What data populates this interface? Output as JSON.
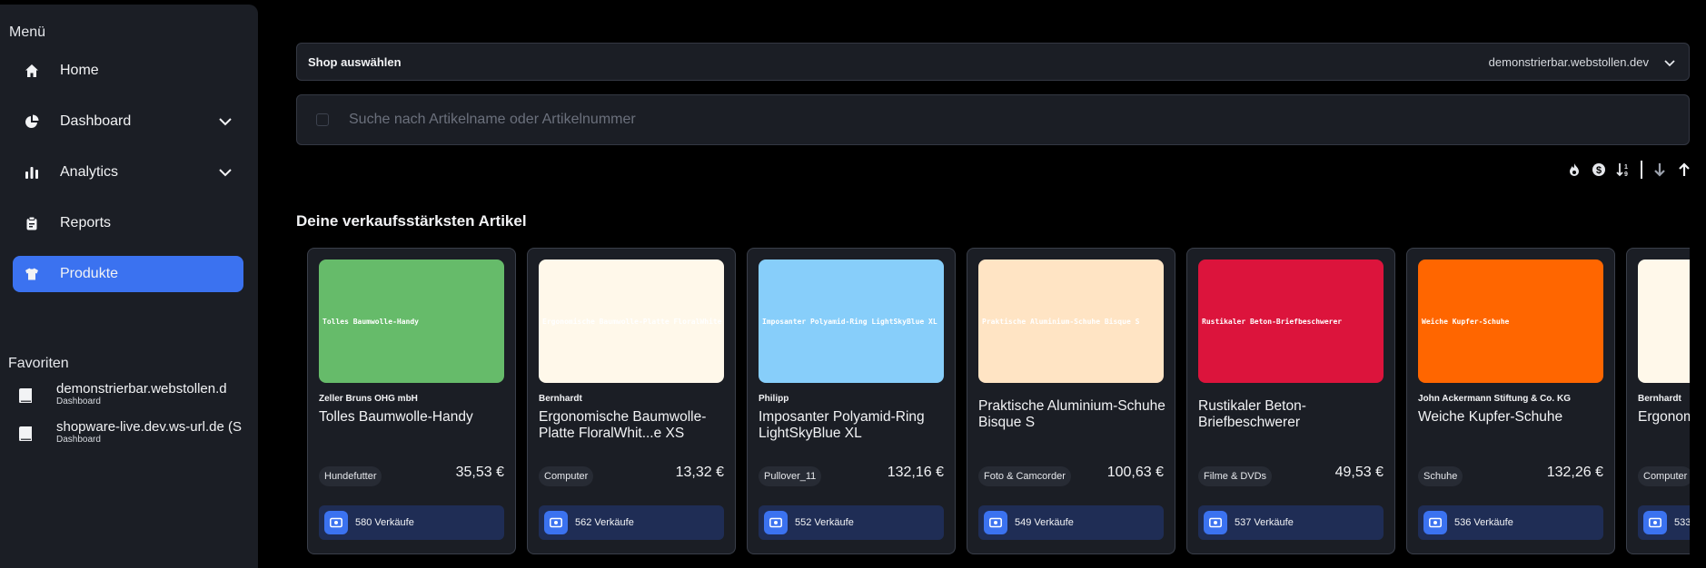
{
  "sidebar": {
    "menu_title": "Menü",
    "items": [
      {
        "label": "Home",
        "icon": "home-icon"
      },
      {
        "label": "Dashboard",
        "icon": "pie-chart-icon",
        "has_dropdown": true
      },
      {
        "label": "Analytics",
        "icon": "bar-chart-icon",
        "has_dropdown": true
      },
      {
        "label": "Reports",
        "icon": "clipboard-icon"
      },
      {
        "label": "Produkte",
        "icon": "shirt-icon",
        "active": true
      }
    ],
    "favorites_title": "Favoriten",
    "favorites": [
      {
        "name": "demonstrierbar.webstollen.d",
        "sub": "Dashboard"
      },
      {
        "name": "shopware-live.dev.ws-url.de (S",
        "sub": "Dashboard"
      }
    ]
  },
  "shop_select": {
    "label": "Shop auswählen",
    "value": "demonstrierbar.webstollen.dev"
  },
  "search": {
    "placeholder": "Suche nach Artikelname oder Artikelnummer",
    "value": ""
  },
  "toolbar": {
    "icons": [
      "flame-icon",
      "dollar-icon",
      "sort-numeric-icon",
      "arrow-down-icon",
      "arrow-up-icon"
    ]
  },
  "section_title": "Deine verkaufsstärksten Artikel",
  "products": [
    {
      "image_text": "Tolles Baumwolle-Handy",
      "image_color": "#66bb6a",
      "vendor": "Zeller Bruns OHG mbH",
      "name": "Tolles Baumwolle-Handy",
      "category": "Hundefutter",
      "price": "35,53 €",
      "sales": "580 Verkäufe"
    },
    {
      "image_text": "Ergonomische Baumwolle-Platte FloralWhite XS",
      "image_color": "#fff8ea",
      "vendor": "Bernhardt",
      "name": "Ergonomische Baumwolle-Platte FloralWhit...e XS",
      "category": "Computer",
      "price": "13,32 €",
      "sales": "562 Verkäufe"
    },
    {
      "image_text": "Imposanter Polyamid-Ring LightSkyBlue XL",
      "image_color": "#87cefa",
      "vendor": "Philipp",
      "name": "Imposanter Polyamid-Ring LightSkyBlue XL",
      "category": "Pullover_11",
      "price": "132,16 €",
      "sales": "552 Verkäufe"
    },
    {
      "image_text": "Praktische Aluminium-Schuhe Bisque S",
      "image_color": "#ffe4c4",
      "vendor": "",
      "name": "Praktische Aluminium-Schuhe Bisque S",
      "category": "Foto & Camcorder",
      "price": "100,63 €",
      "sales": "549 Verkäufe"
    },
    {
      "image_text": "Rustikaler Beton-Briefbeschwerer",
      "image_color": "#dc143c",
      "vendor": "",
      "name": "Rustikaler Beton-Briefbeschwerer",
      "category": "Filme & DVDs",
      "price": "49,53 €",
      "sales": "537 Verkäufe"
    },
    {
      "image_text": "Weiche Kupfer-Schuhe",
      "image_color": "#ff6600",
      "vendor": "John Ackermann Stiftung & Co. KG",
      "name": "Weiche Kupfer-Schuhe",
      "category": "Schuhe",
      "price": "132,26 €",
      "sales": "536 Verkäufe"
    },
    {
      "image_text": "",
      "image_color": "#fff8ea",
      "vendor": "Bernhardt",
      "name": "Ergonomische Platte Fl",
      "category": "Computer",
      "price": "",
      "sales": "533"
    }
  ],
  "colors": {
    "accent": "#3b72f0",
    "panel": "#1b1e25",
    "sales_bg": "#1f2d55"
  }
}
